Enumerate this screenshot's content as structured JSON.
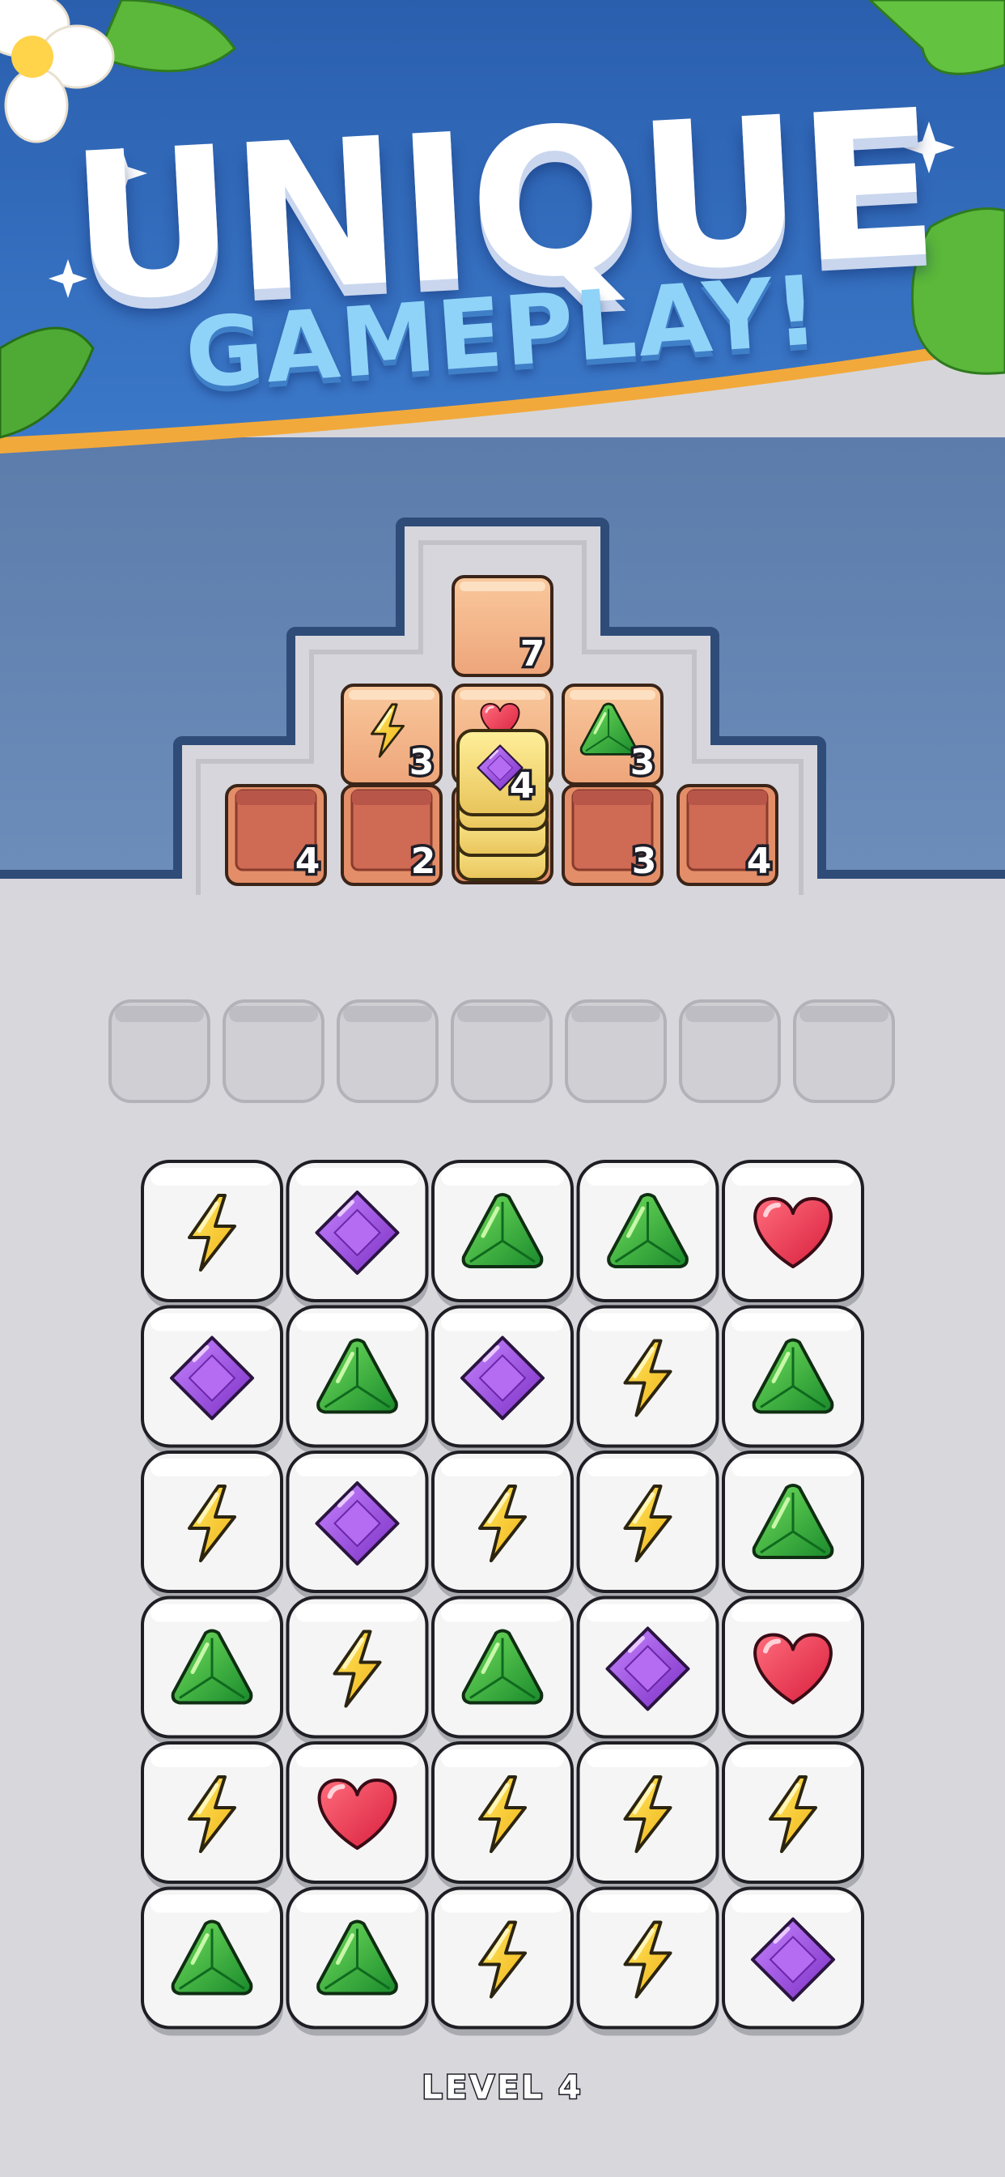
{
  "banner": {
    "title_line1": "UNIQUE",
    "title_line2": "GAMEPLAY!"
  },
  "stacks": {
    "top": {
      "count": "7",
      "icon": "none"
    },
    "middle_left": {
      "count": "3",
      "icon": "bolt"
    },
    "middle_center": {
      "count": "4",
      "icon": "diamond",
      "peek_icon": "heart"
    },
    "middle_right": {
      "count": "3",
      "icon": "emerald"
    },
    "bottom": [
      {
        "count": "4"
      },
      {
        "count": "2"
      },
      {
        "count": "3"
      },
      {
        "count": "4"
      }
    ]
  },
  "tray": {
    "slots": 7
  },
  "board": {
    "rows": [
      [
        "bolt",
        "diamond",
        "emerald",
        "emerald",
        "heart"
      ],
      [
        "diamond",
        "emerald",
        "diamond",
        "bolt",
        "emerald"
      ],
      [
        "bolt",
        "diamond",
        "bolt",
        "bolt",
        "emerald"
      ],
      [
        "emerald",
        "bolt",
        "emerald",
        "diamond",
        "heart"
      ],
      [
        "bolt",
        "heart",
        "bolt",
        "bolt",
        "bolt"
      ],
      [
        "emerald",
        "emerald",
        "bolt",
        "bolt",
        "diamond"
      ]
    ]
  },
  "level_label": "LEVEL 4",
  "colors": {
    "banner_blue": "#2f66b8",
    "banner_trim": "#f2a93b",
    "frame_blue": "#6584b2",
    "tile_white": "#f6f6f6",
    "crate_orange": "#f4b483",
    "bolt": "#f7c928",
    "diamond": "#9d4ae0",
    "emerald": "#2faa3a",
    "heart": "#e8344f"
  }
}
